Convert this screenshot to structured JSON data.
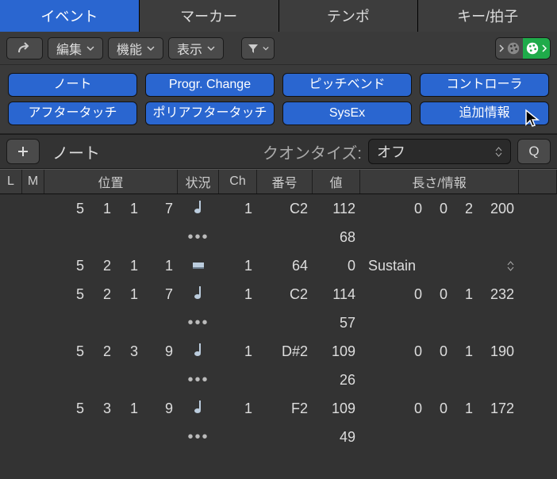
{
  "tabs": {
    "event": "イベント",
    "marker": "マーカー",
    "tempo": "テンポ",
    "keytime": "キー/拍子"
  },
  "toolbar": {
    "edit": "編集",
    "func": "機能",
    "view": "表示"
  },
  "filters": {
    "note": "ノート",
    "progchange": "Progr. Change",
    "pitchbend": "ピッチベンド",
    "controller": "コントローラ",
    "aftertouch": "アフタータッチ",
    "polyat": "ポリアフタータッチ",
    "sysex": "SysEx",
    "extra": "追加情報"
  },
  "row2": {
    "mode": "ノート",
    "q_label": "クオンタイズ:",
    "q_value": "オフ",
    "q_btn": "Q"
  },
  "header": {
    "L": "L",
    "M": "M",
    "pos": "位置",
    "stat": "状況",
    "ch": "Ch",
    "num": "番号",
    "val": "値",
    "len": "長さ/情報"
  },
  "rows": [
    {
      "pos": [
        "5",
        "1",
        "1",
        "7"
      ],
      "icon": "note",
      "ch": "1",
      "num": "C2",
      "val": "112",
      "len": [
        "0",
        "0",
        "2",
        "200"
      ],
      "val2": "68"
    },
    {
      "pos": [
        "5",
        "2",
        "1",
        "1"
      ],
      "icon": "cc",
      "ch": "1",
      "num": "64",
      "val": "0",
      "text": "Sustain"
    },
    {
      "pos": [
        "5",
        "2",
        "1",
        "7"
      ],
      "icon": "note",
      "ch": "1",
      "num": "C2",
      "val": "114",
      "len": [
        "0",
        "0",
        "1",
        "232"
      ],
      "val2": "57"
    },
    {
      "pos": [
        "5",
        "2",
        "3",
        "9"
      ],
      "icon": "note",
      "ch": "1",
      "num": "D#2",
      "val": "109",
      "len": [
        "0",
        "0",
        "1",
        "190"
      ],
      "val2": "26"
    },
    {
      "pos": [
        "5",
        "3",
        "1",
        "9"
      ],
      "icon": "note",
      "ch": "1",
      "num": "F2",
      "val": "109",
      "len": [
        "0",
        "0",
        "1",
        "172"
      ],
      "val2": "49"
    }
  ]
}
